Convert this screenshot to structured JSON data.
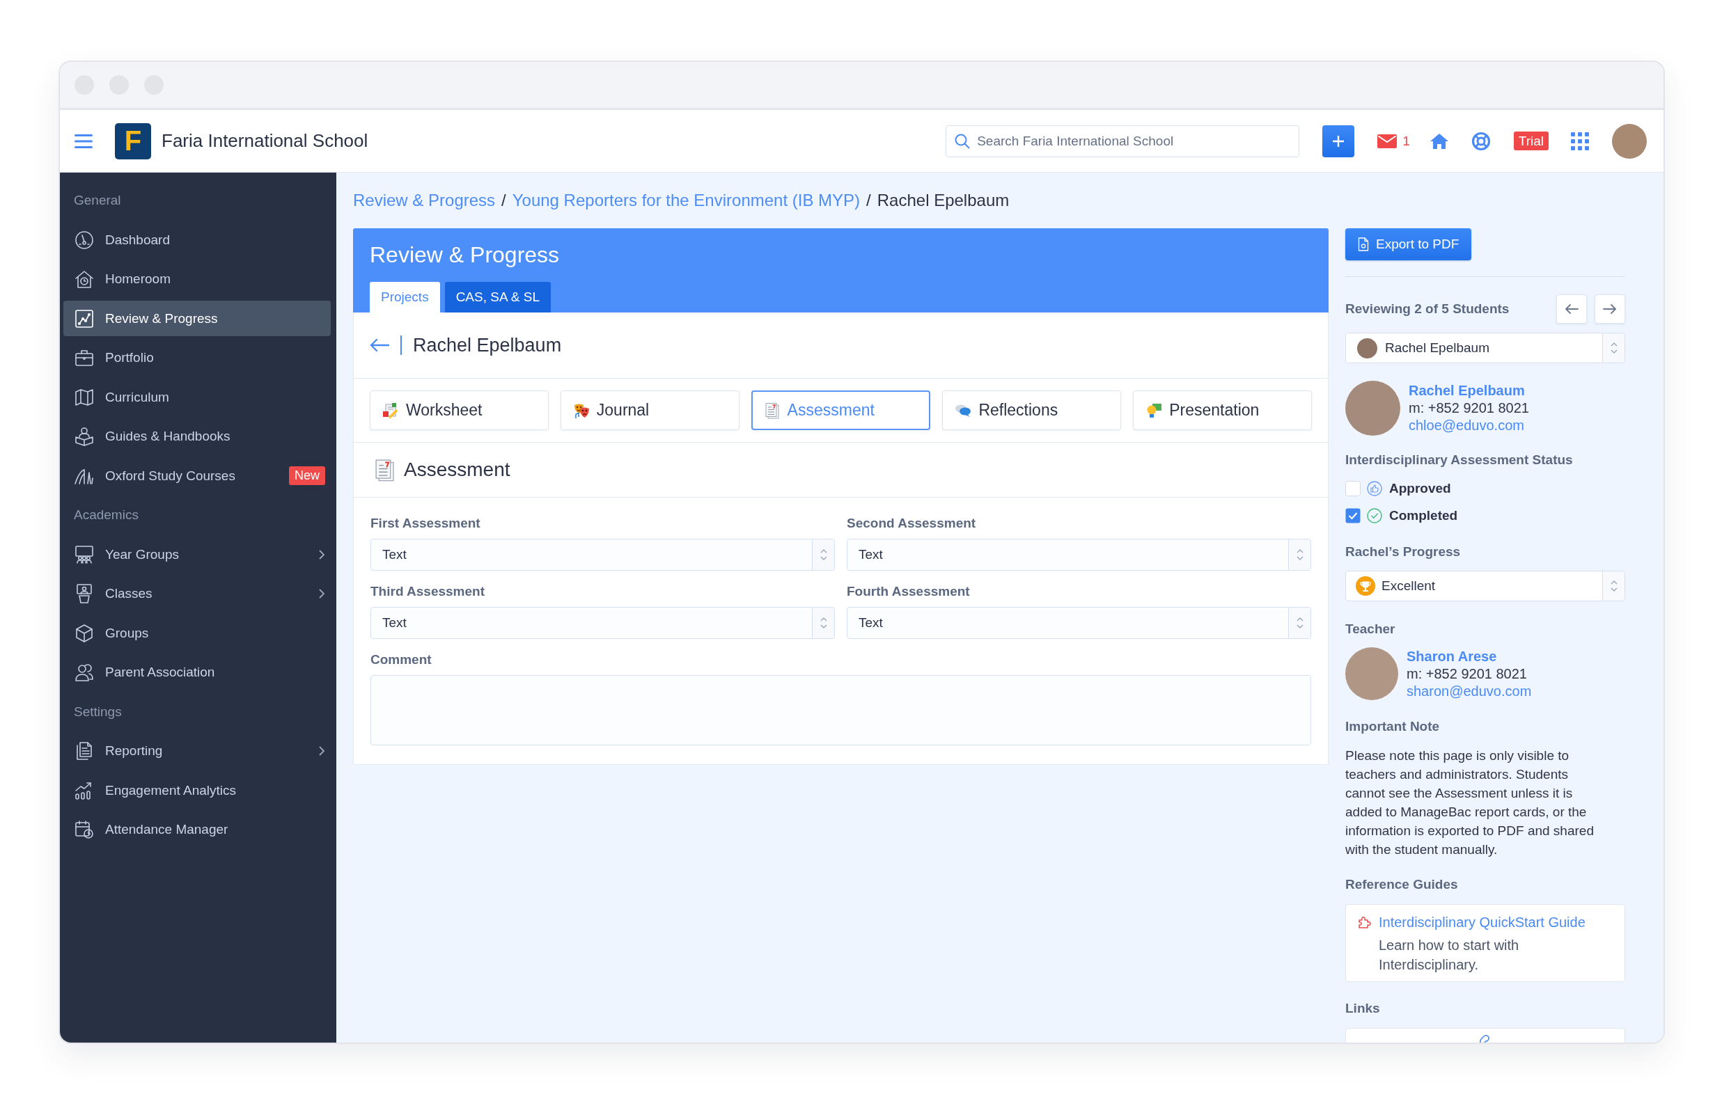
{
  "top_bar": {
    "logo_letter": "F",
    "school_name": "Faria International School",
    "search": {
      "placeholder": "Search Faria International School"
    },
    "mail_count": "1",
    "plan_badge": "Trial"
  },
  "sidebar": {
    "sections": [
      {
        "title": "General",
        "items": [
          {
            "label": "Dashboard",
            "selected": false,
            "submenu": false
          },
          {
            "label": "Homeroom",
            "selected": false,
            "submenu": false
          },
          {
            "label": "Review & Progress",
            "selected": true,
            "submenu": false
          },
          {
            "label": "Portfolio",
            "selected": false,
            "submenu": false
          },
          {
            "label": "Curriculum",
            "selected": false,
            "submenu": false
          },
          {
            "label": "Guides & Handbooks",
            "selected": false,
            "submenu": false
          },
          {
            "label": "Oxford Study Courses",
            "selected": false,
            "submenu": false,
            "badge": "New"
          }
        ]
      },
      {
        "title": "Academics",
        "items": [
          {
            "label": "Year Groups",
            "selected": false,
            "submenu": true
          },
          {
            "label": "Classes",
            "selected": false,
            "submenu": true
          },
          {
            "label": "Groups",
            "selected": false,
            "submenu": false
          },
          {
            "label": "Parent Association",
            "selected": false,
            "submenu": false
          }
        ]
      },
      {
        "title": "Settings",
        "items": [
          {
            "label": "Reporting",
            "selected": false,
            "submenu": true
          },
          {
            "label": "Engagement Analytics",
            "selected": false,
            "submenu": false
          },
          {
            "label": "Attendance Manager",
            "selected": false,
            "submenu": false
          }
        ]
      }
    ]
  },
  "breadcrumb": {
    "items": [
      {
        "label": "Review & Progress",
        "current": false
      },
      {
        "label": "Young Reporters for the Environment (IB MYP)",
        "current": false
      },
      {
        "label": "Rachel Epelbaum",
        "current": true
      }
    ],
    "separators": [
      "/",
      "/"
    ]
  },
  "review_card": {
    "title": "Review & Progress",
    "tabs": [
      {
        "label": "Projects",
        "selected": true
      },
      {
        "label": "CAS, SA & SL",
        "selected": false
      }
    ],
    "student_name": "Rachel Epelbaum",
    "section_tabs": [
      {
        "label": "Worksheet",
        "selected": false
      },
      {
        "label": "Journal",
        "selected": false
      },
      {
        "label": "Assessment",
        "selected": true
      },
      {
        "label": "Reflections",
        "selected": false
      },
      {
        "label": "Presentation",
        "selected": false
      }
    ],
    "section": {
      "title": "Assessment",
      "fields": [
        {
          "label": "First Assessment",
          "value": "Text"
        },
        {
          "label": "Second Assessment",
          "value": "Text"
        },
        {
          "label": "Third Assessment",
          "value": "Text"
        },
        {
          "label": "Fourth Assessment",
          "value": "Text"
        }
      ],
      "comment": {
        "label": "Comment"
      }
    }
  },
  "side_panel": {
    "export_button": "Export to PDF",
    "reviewing": {
      "label": "Reviewing 2 of 5 Students",
      "student_select": "Rachel Epelbaum"
    },
    "student": {
      "name": "Rachel Epelbaum",
      "phone": "m: +852 9201 8021",
      "email": "chloe@eduvo.com"
    },
    "status": {
      "title": "Interdisciplinary Assessment Status",
      "options": [
        {
          "label": "Approved",
          "checked": false
        },
        {
          "label": "Completed",
          "checked": true
        }
      ]
    },
    "progress": {
      "title": "Rachel’s Progress",
      "value": "Excellent"
    },
    "teacher": {
      "title": "Teacher",
      "name": "Sharon Arese",
      "phone": "m: +852 9201 8021",
      "email": "sharon@eduvo.com"
    },
    "note": {
      "title": "Important Note",
      "text": "Please note this page is only visible to teachers and administrators. Students cannot see the Assessment unless it is added to ManageBac report cards, or the information is exported to PDF and shared with the student manually."
    },
    "reference_guides": {
      "title": "Reference Guides",
      "items": [
        {
          "title": "Interdisciplinary QuickStart Guide",
          "description": "Learn how to start with Interdisciplinary."
        }
      ]
    },
    "links": {
      "title": "Links"
    }
  }
}
